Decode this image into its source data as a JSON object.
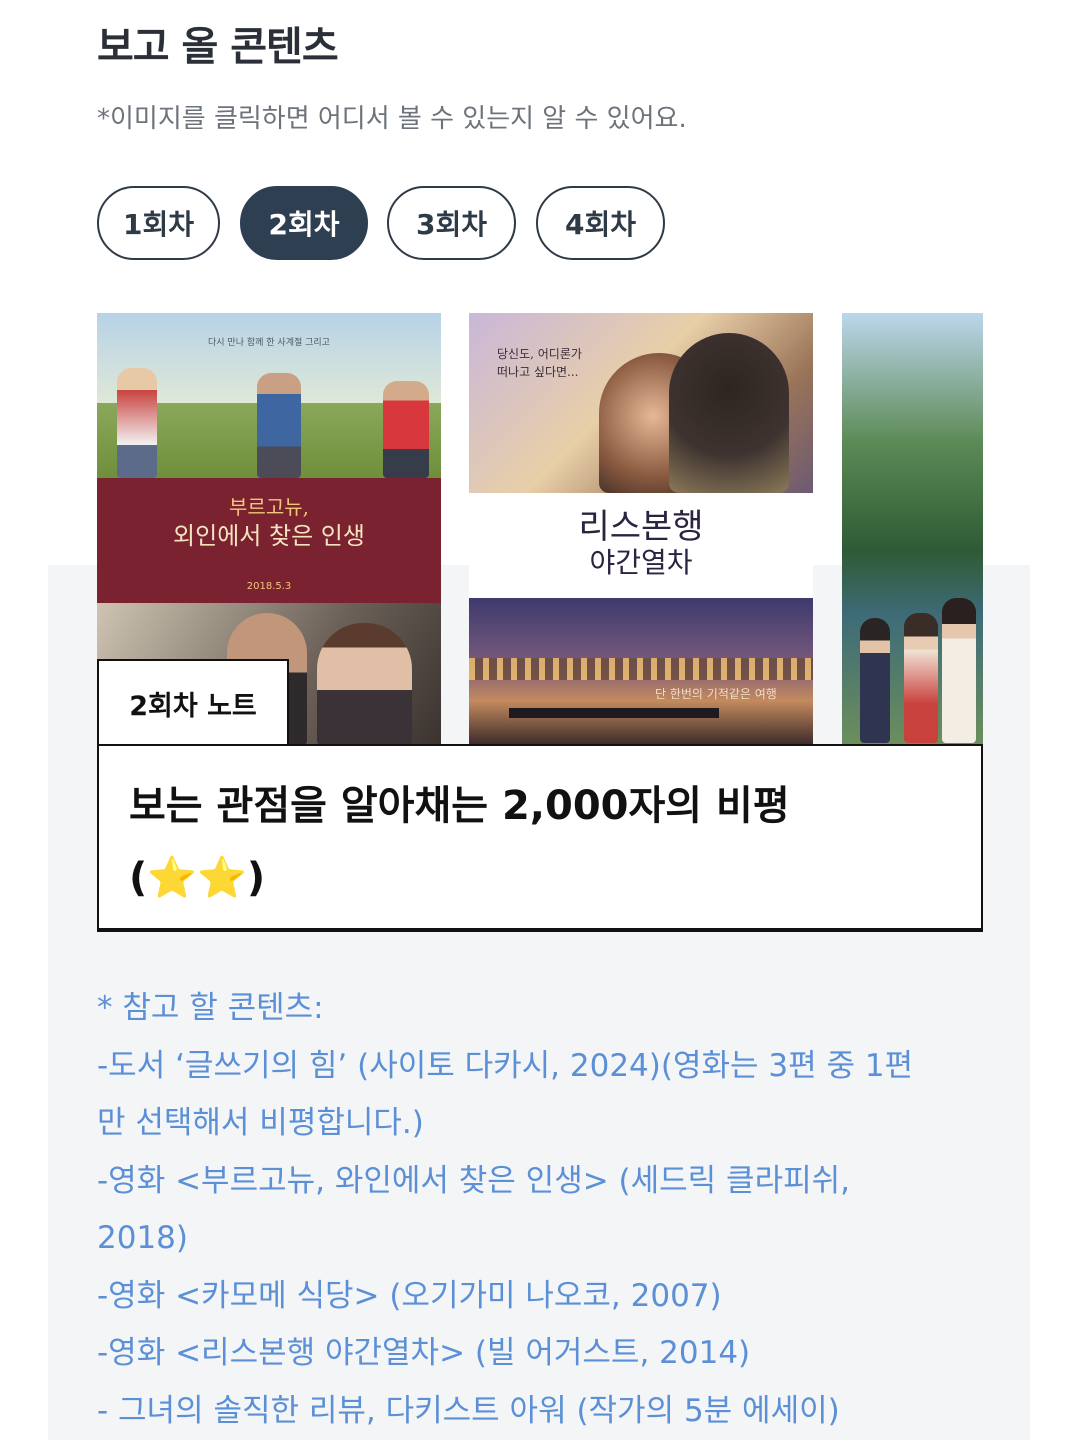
{
  "header": {
    "title": "보고 올 콘텐츠",
    "subtitle": "*이미지를 클릭하면 어디서 볼 수 있는지 알 수 있어요."
  },
  "tabs": [
    {
      "label": "1회차",
      "active": false
    },
    {
      "label": "2회차",
      "active": true
    },
    {
      "label": "3회차",
      "active": false
    },
    {
      "label": "4회차",
      "active": false
    }
  ],
  "posters": {
    "burgundy": {
      "tagline": "다시 만나 함께 한 사계절 그리고",
      "title_line1": "부르고뉴,",
      "title_line2": "외인에서 찾은 인생",
      "date": "2018.5.3"
    },
    "lisbon": {
      "tagline": "당신도, 어디론가\n떠나고 싶다면...",
      "title_line1": "리스본행",
      "title_line2": "야간열차",
      "bottom_text": "단 한번의 기적같은 여행"
    }
  },
  "note": {
    "tag": "2회차 노트",
    "heading": "보는 관점을 알아채는 2,000자의 비평",
    "stars": "(⭐⭐)"
  },
  "references": [
    "* 참고 할 콘텐츠:",
    "-도서 ‘글쓰기의 힘’ (사이토 다카시, 2024)(영화는 3편 중 1편",
    "만 선택해서 비평합니다.)",
    "-영화 <부르고뉴, 와인에서 찾은 인생> (세드릭 클라피쉬,",
    "2018)",
    "-영화 <카모메 식당> (오기가미 나오코, 2007)",
    "-영화 <리스본행 야간열차> (빌 어거스트, 2014)",
    "- 그녀의 솔직한 리뷰, 다키스트 아워 (작가의 5분 에세이)"
  ],
  "colors": {
    "tab_active_bg": "#2f3f52",
    "reference_text": "#5b8fd6",
    "panel_bg": "#f4f5f7"
  }
}
